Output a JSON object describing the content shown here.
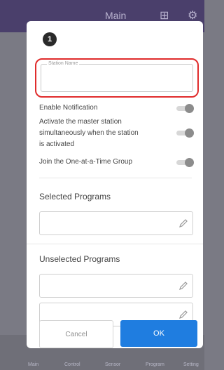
{
  "app_bar": {
    "title": "Main"
  },
  "bottom_nav": {
    "items": [
      "Main",
      "Control",
      "Sensor",
      "Program",
      "Setting"
    ]
  },
  "dialog": {
    "step_number": "1",
    "station_name": {
      "placeholder": "Station Name",
      "value": ""
    },
    "toggles": {
      "enable_notification": {
        "label": "Enable Notification",
        "on": false
      },
      "activate_master": {
        "label_line1": "Activate the master station",
        "label_line2": "simultaneously when the station",
        "label_line3": "is activated",
        "on": false
      },
      "one_at_a_time": {
        "label": "Join the One-at-a-Time Group",
        "on": false
      }
    },
    "selected_programs": {
      "title": "Selected Programs"
    },
    "unselected_programs": {
      "title": "Unselected Programs"
    },
    "buttons": {
      "cancel": "Cancel",
      "ok": "OK"
    }
  },
  "colors": {
    "accent": "#1f7de0",
    "highlight_border": "#e02c2c",
    "app_bar": "#4a3f6b"
  }
}
